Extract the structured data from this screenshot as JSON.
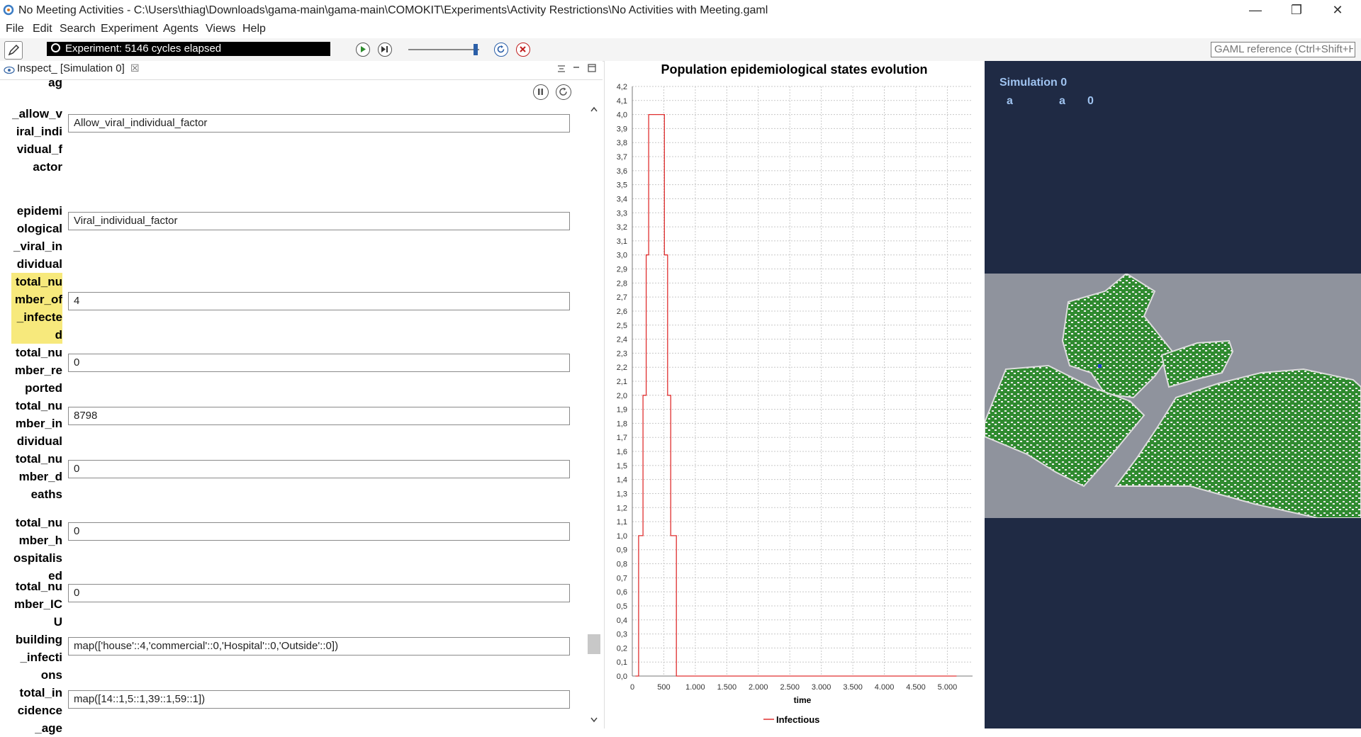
{
  "window": {
    "title": "No Meeting Activities - C:\\Users\\thiag\\Downloads\\gama-main\\gama-main\\COMOKIT\\Experiments\\Activity Restrictions\\No Activities with Meeting.gaml",
    "app_icon": "gama-icon",
    "minimize": "—",
    "restore": "❐",
    "close": "✕"
  },
  "menu": [
    "File",
    "Edit",
    "Search",
    "Experiment",
    "Agents",
    "Views",
    "Help"
  ],
  "toolbar": {
    "status": "Experiment: 5146 cycles elapsed",
    "gaml_reference_placeholder": "GAML reference (Ctrl+Shift+H)",
    "icons": [
      "edit-icon",
      "timer-icon",
      "play-icon",
      "step-icon",
      "speed-slider",
      "reload-icon",
      "stop-icon"
    ]
  },
  "inspect": {
    "tab_label": "Inspect_  [Simulation 0]",
    "tab_close": "☒",
    "partial_label_top": "ag",
    "params": [
      {
        "label": "_allow_v\niral_indi\nvidual_f\nactor",
        "value": "Allow_viral_individual_factor",
        "highlight": false
      },
      {
        "label": "epidemi\nological\n_viral_in\ndividual\n_factor",
        "value": "Viral_individual_factor",
        "highlight": false
      },
      {
        "label": "total_nu\nmber_of\n_infecte\nd",
        "value": "4",
        "highlight": true
      },
      {
        "label": "total_nu\nmber_re\nported",
        "value": "0",
        "highlight": false
      },
      {
        "label": "total_nu\nmber_in\ndividual",
        "value": "8798",
        "highlight": false
      },
      {
        "label": "total_nu\nmber_d\neaths",
        "value": "0",
        "highlight": false
      },
      {
        "label": "total_nu\nmber_h\nospitalis\ned",
        "value": "0",
        "highlight": false
      },
      {
        "label": "total_nu\nmber_IC\nU",
        "value": "0",
        "highlight": false
      },
      {
        "label": "building\n_infecti\nons",
        "value": "map(['house'::4,'commercial'::0,'Hospital'::0,'Outside'::0])",
        "highlight": false
      },
      {
        "label": "total_in\ncidence\n_age",
        "value": "map([14::1,5::1,39::1,59::1])",
        "highlight": false
      }
    ]
  },
  "colors": {
    "series": "#e03030",
    "map_background": "#1f2a44",
    "map_ground": "#8f939d",
    "buildings": "#2e8b2e",
    "label_highlight": "#f7e97c"
  },
  "chart_data": {
    "type": "line",
    "title": "Population epidemiological states evolution",
    "xlabel": "time",
    "ylabel": "",
    "xlim": [
      0,
      5400
    ],
    "ylim": [
      0,
      4.2
    ],
    "x_ticks": [
      0,
      500,
      1000,
      1500,
      2000,
      2500,
      3000,
      3500,
      4000,
      4500,
      5000
    ],
    "x_tick_labels": [
      "0",
      "500",
      "1.000",
      "1.500",
      "2.000",
      "2.500",
      "3.000",
      "3.500",
      "4.000",
      "4.500",
      "5.000"
    ],
    "y_tick_step": 0.1,
    "grid": true,
    "legend": "bottom",
    "series": [
      {
        "name": "Infectious",
        "color": "#e03030",
        "points": [
          [
            50,
            0
          ],
          [
            100,
            0
          ],
          [
            100,
            1
          ],
          [
            170,
            1
          ],
          [
            170,
            2
          ],
          [
            220,
            2
          ],
          [
            220,
            3
          ],
          [
            260,
            3
          ],
          [
            260,
            4
          ],
          [
            510,
            4
          ],
          [
            510,
            3
          ],
          [
            560,
            3
          ],
          [
            560,
            2
          ],
          [
            610,
            2
          ],
          [
            610,
            1
          ],
          [
            700,
            1
          ],
          [
            700,
            0
          ],
          [
            5146,
            0
          ]
        ]
      }
    ]
  },
  "map": {
    "simulation_label": "Simulation 0",
    "agent_label_1": "a",
    "agent_label_2": "a",
    "agent_count": "0"
  }
}
